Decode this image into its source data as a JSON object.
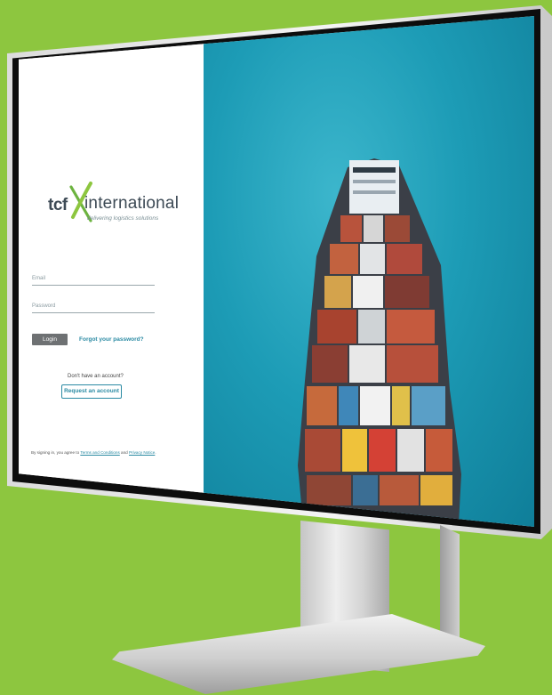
{
  "brand": {
    "name_short": "tcf",
    "name_long": "international",
    "tagline": "delivering logistics solutions",
    "colors": {
      "green": "#8dc63f",
      "teal": "#2a8aa3",
      "dark": "#3d4a55"
    }
  },
  "login": {
    "email_label": "Email",
    "password_label": "Password",
    "login_button": "Login",
    "forgot_link": "Forgot your password?",
    "no_account_text": "Don't have an account?",
    "request_button": "Request an account",
    "terms_prefix": "By signing in, you agree to ",
    "terms_link": "Terms and Conditions",
    "terms_and": " and ",
    "privacy_link": "Privacy Notice",
    "terms_suffix": "."
  },
  "hero": {
    "image": "container-ship-aerial"
  },
  "icons": {
    "logo_mark": "tcf-x-logo-icon"
  }
}
